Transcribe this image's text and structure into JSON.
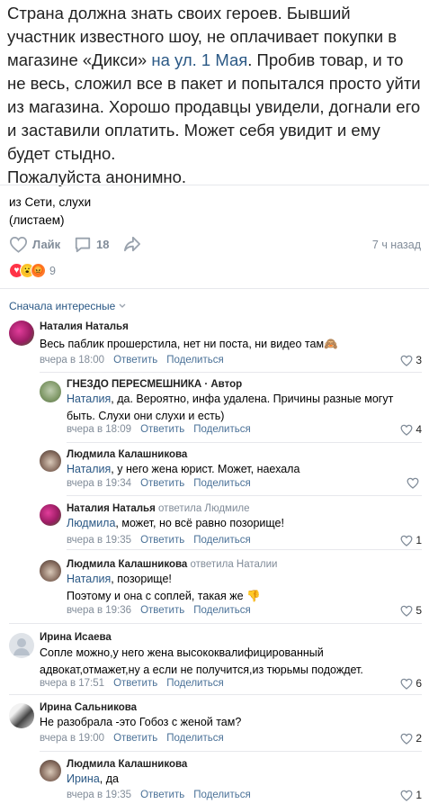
{
  "post": {
    "text_before_link": "Страна должна знать своих героев. Бывший участник известного шоу, не оплачивает покупки в магазине «Дикси» ",
    "link": "на ул. 1 Мая",
    "text_after_link": ". Пробив товар, и то не весь, сложил все в пакет и попытался просто уйти из магазина. Хорошо продавцы увидели, догнали его и заставили оплатить. Может себя увидит и ему будет стыдно.",
    "text_last": "Пожалуйста анонимно.",
    "source_line1": "из Сети, слухи",
    "source_line2": "(листаем)"
  },
  "actions": {
    "like_label": "Лайк",
    "comments_count": "18",
    "time_ago": "7 ч назад"
  },
  "reactions": {
    "count": "9"
  },
  "sort_label": "Сначала интересные",
  "comments": [
    {
      "author": "Наталия Наталья",
      "reply_to": "",
      "mention": "",
      "text": "Весь паблик прошерстила, нет ни поста, ни видео там🙈",
      "time": "вчера в 18:00",
      "reply_label": "Ответить",
      "share_label": "Поделиться",
      "likes": "3"
    },
    {
      "author": "ГНЕЗДО ПЕРЕСМЕШНИКА · Автор",
      "reply_to": "",
      "mention": "Наталия",
      "text": ", да. Вероятно, инфа удалена. Причины разные могут быть. Слухи они слухи и есть)",
      "time": "вчера в 18:09",
      "reply_label": "Ответить",
      "share_label": "Поделиться",
      "likes": "4"
    },
    {
      "author": "Людмила Калашникова",
      "reply_to": "",
      "mention": "Наталия",
      "text": ", у него жена юрист. Может, наехала",
      "time": "вчера в 19:34",
      "reply_label": "Ответить",
      "share_label": "Поделиться",
      "likes": ""
    },
    {
      "author": "Наталия Наталья",
      "reply_to": "ответила Людмиле",
      "mention": "Людмила",
      "text": ", может, но всё равно позорище!",
      "time": "вчера в 19:35",
      "reply_label": "Ответить",
      "share_label": "Поделиться",
      "likes": "1"
    },
    {
      "author": "Людмила Калашникова",
      "reply_to": "ответила Наталии",
      "mention": "Наталия",
      "text": ", позорище!",
      "text2": "Поэтому и она с соплей, такая же 👎",
      "time": "вчера в 19:36",
      "reply_label": "Ответить",
      "share_label": "Поделиться",
      "likes": "5"
    },
    {
      "author": "Ирина Исаева",
      "reply_to": "",
      "mention": "",
      "text": "Сопле можно,у него жена высококвалифицированный адвокат,отмажет,ну а если не получится,из тюрьмы подождет.",
      "time": "вчера в 17:51",
      "reply_label": "Ответить",
      "share_label": "Поделиться",
      "likes": "6"
    },
    {
      "author": "Ирина Сальникова",
      "reply_to": "",
      "mention": "",
      "text": "Не разобрала -это Гобоз с женой там?",
      "time": "вчера в 19:00",
      "reply_label": "Ответить",
      "share_label": "Поделиться",
      "likes": "2"
    },
    {
      "author": "Людмила Калашникова",
      "reply_to": "",
      "mention": "Ирина",
      "text": ", да",
      "time": "вчера в 19:35",
      "reply_label": "Ответить",
      "share_label": "Поделиться",
      "likes": "1"
    }
  ]
}
